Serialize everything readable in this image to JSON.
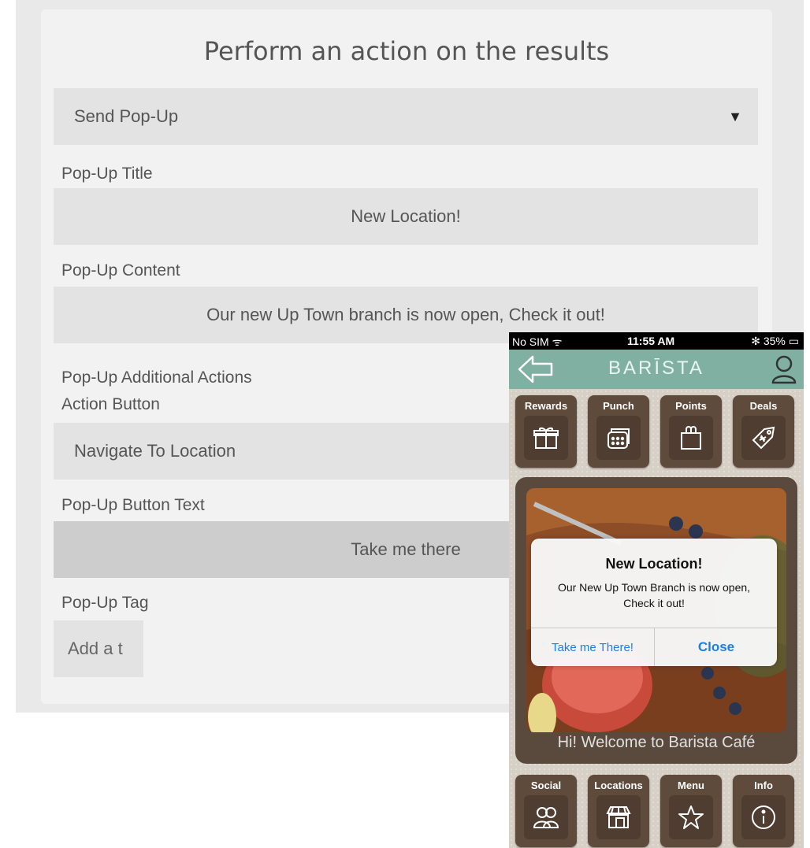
{
  "form": {
    "title": "Perform an action on the results",
    "action_select": {
      "value": "Send Pop-Up",
      "caret": "▼"
    },
    "popup_title": {
      "label": "Pop-Up Title",
      "value": "New Location!"
    },
    "popup_content": {
      "label": "Pop-Up Content",
      "value": "Our new Up Town branch is now open, Check it out!"
    },
    "additional_actions": {
      "label": "Pop-Up Additional Actions",
      "sublabel": "Action Button",
      "value": "Navigate To Location"
    },
    "button_text": {
      "label": "Pop-Up Button Text",
      "value": "Take me there"
    },
    "tag": {
      "label": "Pop-Up Tag",
      "placeholder": "Add a t"
    }
  },
  "phone": {
    "status": {
      "carrier": "No SIM ᯤ",
      "time": "11:55 AM",
      "battery": "✻ 35% ▭"
    },
    "app_name": "BARĪSTA",
    "top_tiles": [
      {
        "label": "Rewards",
        "icon": "gift-icon"
      },
      {
        "label": "Punch",
        "icon": "punch-card-icon"
      },
      {
        "label": "Points",
        "icon": "shopping-bag-icon"
      },
      {
        "label": "Deals",
        "icon": "tag-icon"
      }
    ],
    "bottom_tiles": [
      {
        "label": "Social",
        "icon": "people-icon"
      },
      {
        "label": "Locations",
        "icon": "store-icon"
      },
      {
        "label": "Menu",
        "icon": "star-icon"
      },
      {
        "label": "Info",
        "icon": "info-icon"
      }
    ],
    "welcome": "Hi! Welcome to Barista Café",
    "alert": {
      "title": "New Location!",
      "message": "Our New Up Town Branch is now open, Check it out!",
      "action_button": "Take me There!",
      "close_button": "Close"
    }
  },
  "colors": {
    "header_teal": "#7fb0a2",
    "tile_brown": "#5f4b3c",
    "ios_blue": "#1a7fe6"
  }
}
